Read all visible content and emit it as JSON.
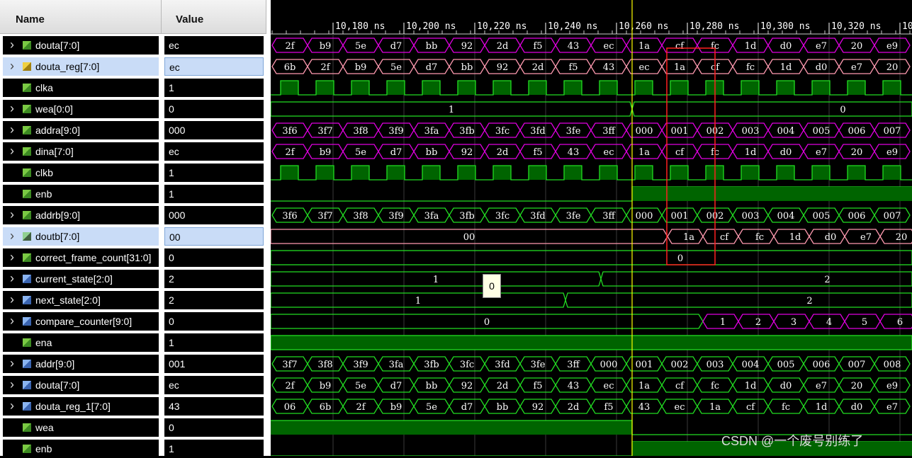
{
  "header": {
    "name_label": "Name",
    "value_label": "Value"
  },
  "time_labels": [
    "10,180 ns",
    "10,200 ns",
    "10,220 ns",
    "10,240 ns",
    "10,260 ns",
    "10,280 ns",
    "10,300 ns",
    "10,320 ns",
    "10,3"
  ],
  "colors": {
    "bus": "#e000e0",
    "green": "#22dd22",
    "pink": "#ff9ab0",
    "fill": "#006400",
    "cursor": "#ffff00",
    "marker": "#ff2020"
  },
  "signals": [
    {
      "name": "douta[7:0]",
      "value": "ec",
      "bus": true,
      "icon": "bus",
      "selected": false,
      "color": "bus",
      "labels": [
        "2f",
        "b9",
        "5e",
        "d7",
        "bb",
        "92",
        "2d",
        "f5",
        "43",
        "ec",
        "1a",
        "cf",
        "fc",
        "1d",
        "d0",
        "e7",
        "20",
        "e9"
      ]
    },
    {
      "name": "douta_reg[7:0]",
      "value": "ec",
      "bus": true,
      "icon": "reg",
      "selected": true,
      "color": "pink",
      "labels": [
        "6b",
        "2f",
        "b9",
        "5e",
        "d7",
        "bb",
        "92",
        "2d",
        "f5",
        "43",
        "ec",
        "1a",
        "cf",
        "fc",
        "1d",
        "d0",
        "e7",
        "20"
      ]
    },
    {
      "name": "clka",
      "value": "1",
      "bus": false,
      "icon": "bit",
      "selected": false,
      "kind": "clock"
    },
    {
      "name": "wea[0:0]",
      "value": "0",
      "bus": true,
      "icon": "bus",
      "selected": false,
      "kind": "change",
      "values": [
        "1",
        "0"
      ]
    },
    {
      "name": "addra[9:0]",
      "value": "000",
      "bus": true,
      "icon": "bus",
      "selected": false,
      "color": "bus",
      "labels": [
        "3f6",
        "3f7",
        "3f8",
        "3f9",
        "3fa",
        "3fb",
        "3fc",
        "3fd",
        "3fe",
        "3ff",
        "000",
        "001",
        "002",
        "003",
        "004",
        "005",
        "006",
        "007"
      ]
    },
    {
      "name": "dina[7:0]",
      "value": "ec",
      "bus": true,
      "icon": "bus",
      "selected": false,
      "color": "bus",
      "labels": [
        "2f",
        "b9",
        "5e",
        "d7",
        "bb",
        "92",
        "2d",
        "f5",
        "43",
        "ec",
        "1a",
        "cf",
        "fc",
        "1d",
        "d0",
        "e7",
        "20",
        "e9"
      ]
    },
    {
      "name": "clkb",
      "value": "1",
      "bus": false,
      "icon": "bit",
      "selected": false,
      "kind": "clock"
    },
    {
      "name": "enb",
      "value": "1",
      "bus": false,
      "icon": "bit",
      "selected": false,
      "kind": "enb"
    },
    {
      "name": "addrb[9:0]",
      "value": "000",
      "bus": true,
      "icon": "bus",
      "selected": false,
      "color": "green",
      "labels": [
        "3f6",
        "3f7",
        "3f8",
        "3f9",
        "3fa",
        "3fb",
        "3fc",
        "3fd",
        "3fe",
        "3ff",
        "000",
        "001",
        "002",
        "003",
        "004",
        "005",
        "006",
        "007"
      ]
    },
    {
      "name": "doutb[7:0]",
      "value": "00",
      "bus": true,
      "icon": "mem",
      "selected": true,
      "kind": "doutb",
      "values": [
        "00",
        "1a",
        "cf",
        "fc",
        "1d",
        "d0",
        "e7",
        "20"
      ]
    },
    {
      "name": "correct_frame_count[31:0]",
      "value": "0",
      "bus": true,
      "icon": "bus",
      "selected": false,
      "kind": "const",
      "values": [
        "0"
      ]
    },
    {
      "name": "current_state[2:0]",
      "value": "2",
      "bus": true,
      "icon": "state",
      "selected": false,
      "kind": "change",
      "values": [
        "1",
        "2"
      ]
    },
    {
      "name": "next_state[2:0]",
      "value": "2",
      "bus": true,
      "icon": "state",
      "selected": false,
      "kind": "change",
      "values": [
        "1",
        "2"
      ]
    },
    {
      "name": "compare_counter[9:0]",
      "value": "0",
      "bus": true,
      "icon": "state",
      "selected": false,
      "kind": "counter",
      "values": [
        "0",
        "1",
        "2",
        "3",
        "4",
        "5",
        "6"
      ]
    },
    {
      "name": "ena",
      "value": "1",
      "bus": false,
      "icon": "bit",
      "selected": false,
      "kind": "high"
    },
    {
      "name": "addr[9:0]",
      "value": "001",
      "bus": true,
      "icon": "state",
      "selected": false,
      "color": "green",
      "labels": [
        "3f7",
        "3f8",
        "3f9",
        "3fa",
        "3fb",
        "3fc",
        "3fd",
        "3fe",
        "3ff",
        "000",
        "001",
        "002",
        "003",
        "004",
        "005",
        "006",
        "007",
        "008"
      ]
    },
    {
      "name": "douta[7:0]",
      "value": "ec",
      "bus": true,
      "icon": "state",
      "selected": false,
      "color": "green",
      "labels": [
        "2f",
        "b9",
        "5e",
        "d7",
        "bb",
        "92",
        "2d",
        "f5",
        "43",
        "ec",
        "1a",
        "cf",
        "fc",
        "1d",
        "d0",
        "e7",
        "20",
        "e9"
      ]
    },
    {
      "name": "douta_reg_1[7:0]",
      "value": "43",
      "bus": true,
      "icon": "state",
      "selected": false,
      "color": "green",
      "labels": [
        "06",
        "6b",
        "2f",
        "b9",
        "5e",
        "d7",
        "bb",
        "92",
        "2d",
        "f5",
        "43",
        "ec",
        "1a",
        "cf",
        "fc",
        "1d",
        "d0",
        "e7"
      ]
    },
    {
      "name": "wea",
      "value": "0",
      "bus": false,
      "icon": "bit",
      "selected": false,
      "kind": "wea"
    },
    {
      "name": "enb",
      "value": "1",
      "bus": false,
      "icon": "bit",
      "selected": false,
      "kind": "enb"
    }
  ],
  "tooltip": {
    "value": "0"
  },
  "watermark": "CSDN @一个废号别练了"
}
